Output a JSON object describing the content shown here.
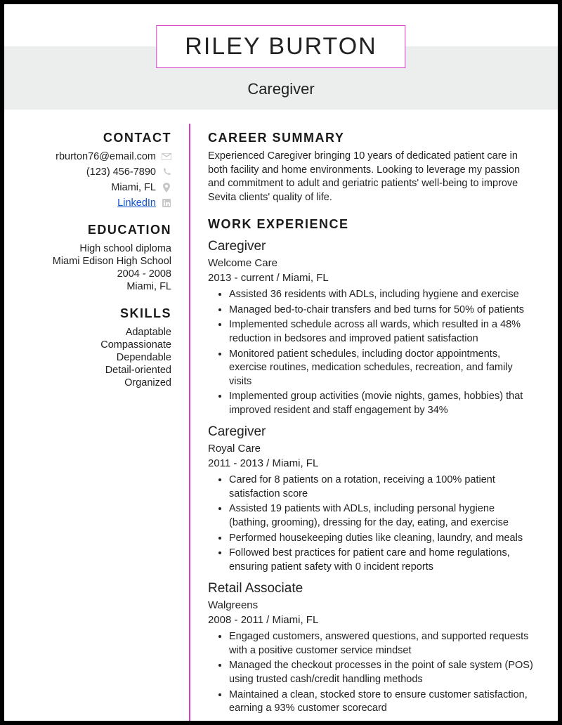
{
  "header": {
    "name": "RILEY BURTON",
    "title": "Caregiver"
  },
  "sidebar": {
    "contact_heading": "CONTACT",
    "contact": {
      "email": "rburton76@email.com",
      "phone": "(123) 456-7890",
      "location": "Miami, FL",
      "linkedin_label": "LinkedIn"
    },
    "education_heading": "EDUCATION",
    "education": {
      "degree": "High school diploma",
      "school": "Miami Edison High School",
      "dates": "2004 - 2008",
      "location": "Miami, FL"
    },
    "skills_heading": "SKILLS",
    "skills": [
      "Adaptable",
      "Compassionate",
      "Dependable",
      "Detail-oriented",
      "Organized"
    ]
  },
  "main": {
    "summary_heading": "CAREER SUMMARY",
    "summary": "Experienced Caregiver bringing 10 years of dedicated patient care in both facility and home environments. Looking to leverage my passion and commitment to adult and geriatric patients' well-being to improve Sevita clients' quality of life.",
    "experience_heading": "WORK EXPERIENCE",
    "jobs": [
      {
        "title": "Caregiver",
        "org": "Welcome Care",
        "meta": "2013 - current   /   Miami, FL",
        "bullets": [
          "Assisted 36 residents with ADLs, including hygiene and exercise",
          "Managed bed-to-chair transfers and bed turns for 50% of patients",
          "Implemented schedule across all wards, which resulted in a 48% reduction in bedsores and improved patient satisfaction",
          "Monitored patient schedules, including doctor appointments, exercise routines, medication schedules, recreation, and family visits",
          "Implemented group activities (movie nights, games, hobbies) that improved resident and staff engagement by 34%"
        ]
      },
      {
        "title": "Caregiver",
        "org": "Royal Care",
        "meta": "2011 - 2013   /   Miami, FL",
        "bullets": [
          "Cared for 8 patients on a rotation, receiving a 100% patient satisfaction score",
          "Assisted 19 patients with ADLs, including personal hygiene (bathing, grooming), dressing for the day, eating, and exercise",
          "Performed housekeeping duties like cleaning, laundry, and meals",
          "Followed best practices for patient care and home regulations, ensuring patient safety with 0 incident reports"
        ]
      },
      {
        "title": "Retail Associate",
        "org": "Walgreens",
        "meta": "2008 - 2011   /   Miami, FL",
        "bullets": [
          "Engaged customers, answered questions, and supported requests with a positive customer service mindset",
          "Managed the checkout processes in the point of sale system (POS) using trusted cash/credit handling methods",
          "Maintained a clean, stocked store to ensure customer satisfaction, earning a 93% customer scorecard"
        ]
      }
    ]
  }
}
